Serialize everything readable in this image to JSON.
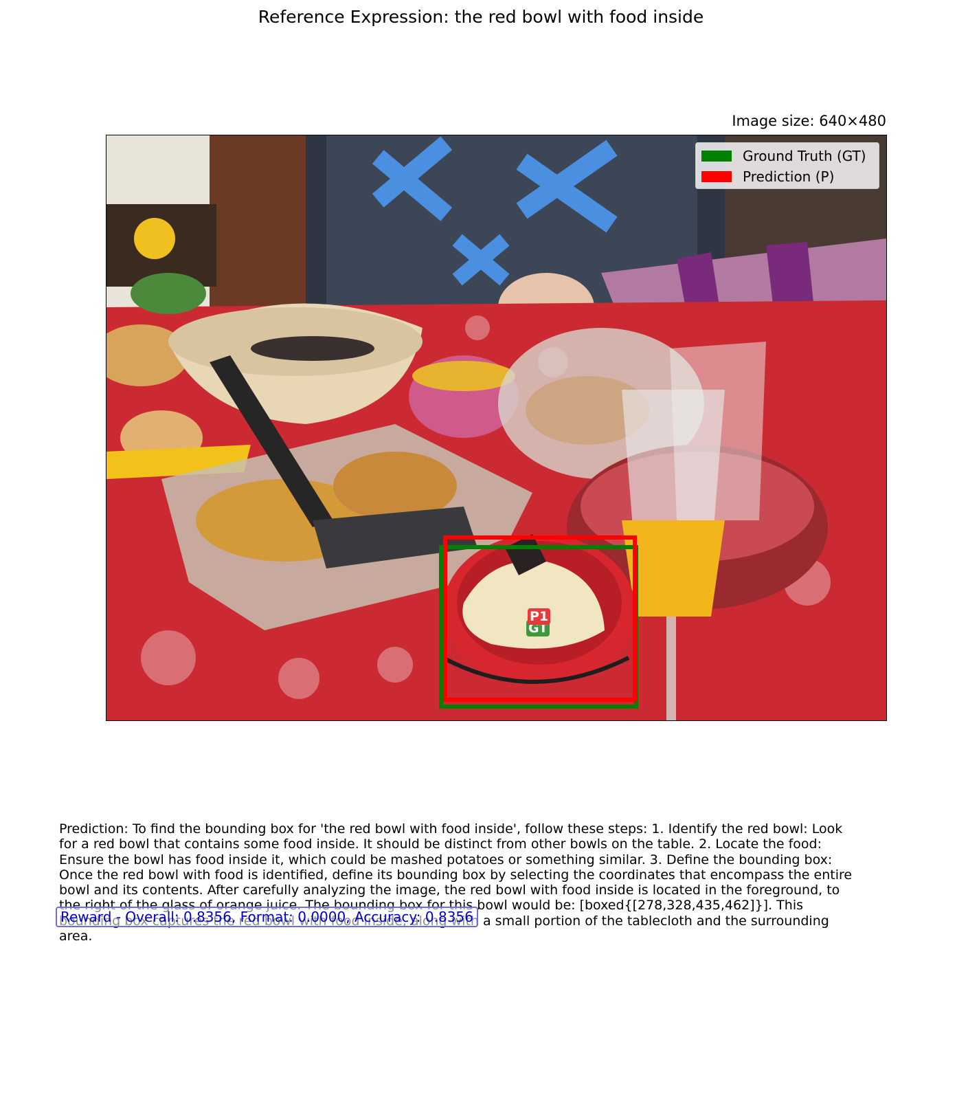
{
  "title": "Reference Expression: the red bowl with food inside",
  "image_size_label": "Image size: 640×480",
  "legend": {
    "gt_label": "Ground Truth (GT)",
    "pred_label": "Prediction (P)",
    "gt_color": "#008000",
    "pred_color": "#ff0000"
  },
  "boxes": {
    "gt_tag": "GT",
    "pred_tag": "P1"
  },
  "prediction_text": "Prediction: To find the bounding box for 'the red bowl with food inside', follow these steps:  1. Identify the red bowl: Look for a red bowl that contains some food inside. It should be distinct from other bowls on the table. 2. Locate the food: Ensure the bowl has food inside it, which could be mashed potatoes or something similar. 3. Define the bounding box: Once the red bowl with food is identified, define its bounding box by selecting the coordinates that encompass the entire bowl and its contents.  After carefully analyzing the image, the red bowl with food inside is located in the foreground, to the right of the glass of orange juice. The bounding box for this bowl would be: [boxed{[278,328,435,462]}]. This bounding box captures the red bowl with food inside, along with a small portion of the tablecloth and the surrounding area.",
  "reward_text": "Reward - Overall: 0.8356, Format: 0.0000, Accuracy: 0.8356"
}
